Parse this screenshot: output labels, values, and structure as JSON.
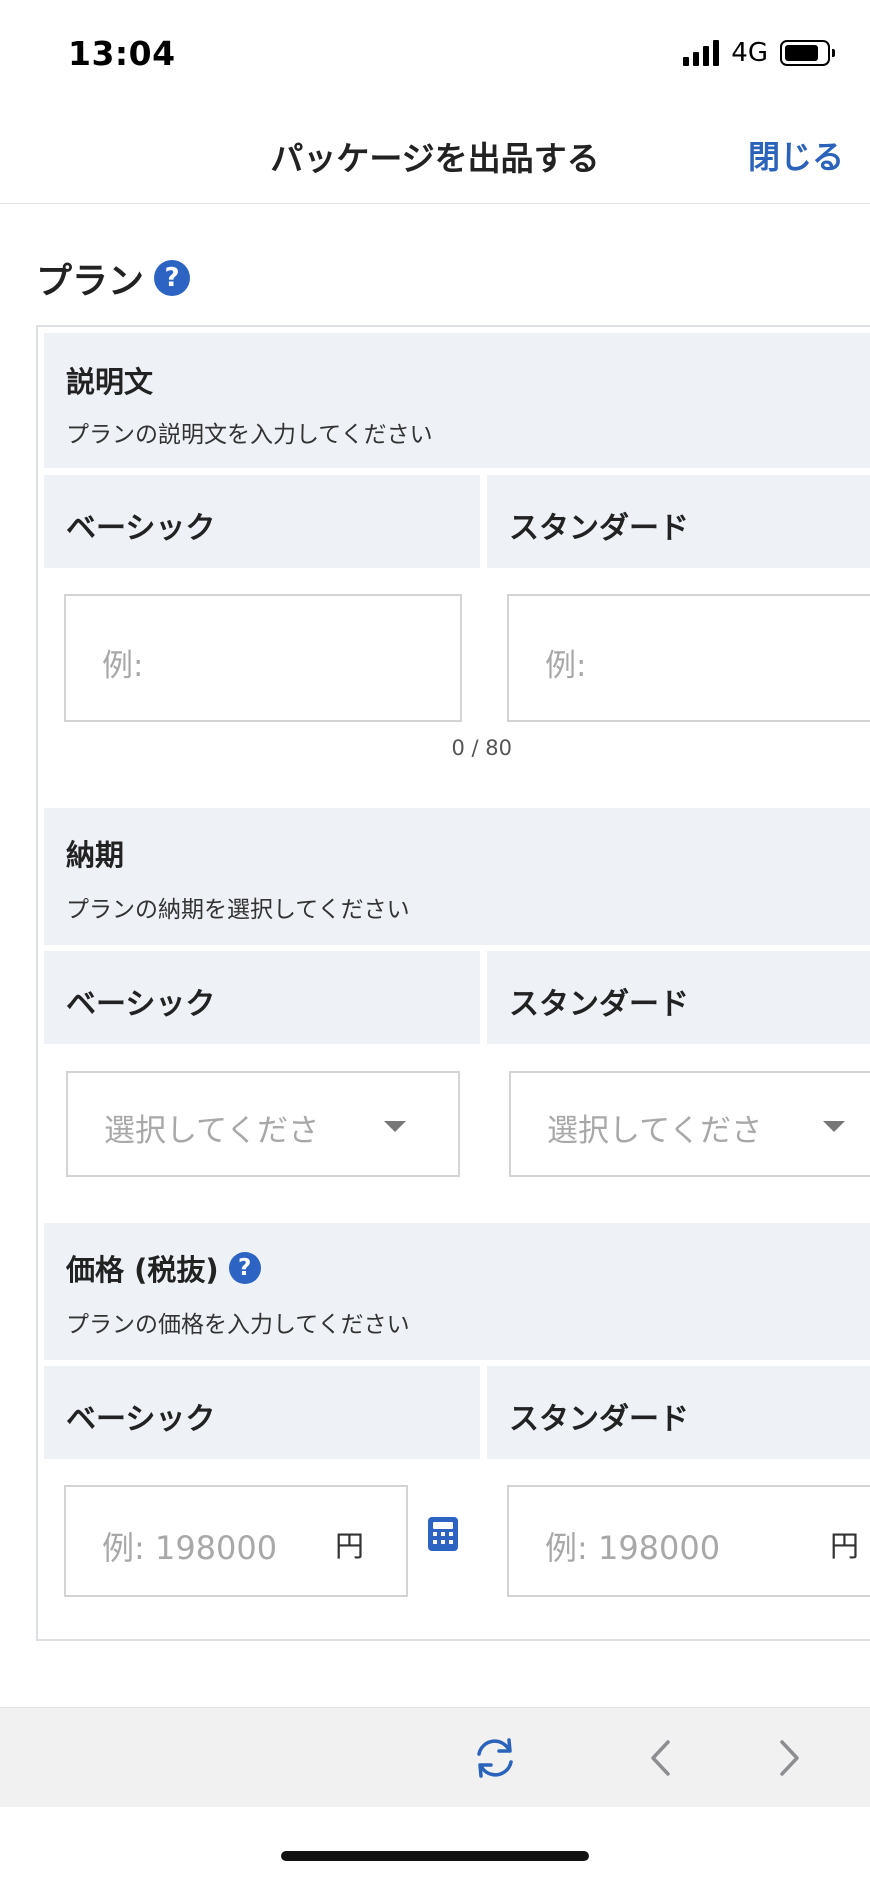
{
  "status_bar": {
    "time": "13:04",
    "network": "4G",
    "icons": [
      "signal-icon",
      "battery-icon"
    ]
  },
  "header": {
    "title": "パッケージを出品する",
    "close_label": "閉じる"
  },
  "plan": {
    "title": "プラン",
    "help_icon": "question-circle-icon"
  },
  "description_section": {
    "title": "説明文",
    "hint": "プランの説明文を入力してください",
    "columns": [
      {
        "label": "ベーシック",
        "placeholder": "例:",
        "counter": "0 / 80"
      },
      {
        "label": "スタンダード",
        "placeholder": "例:"
      }
    ]
  },
  "delivery_section": {
    "title": "納期",
    "hint": "プランの納期を選択してください",
    "columns": [
      {
        "label": "ベーシック",
        "placeholder": "選択してくださ"
      },
      {
        "label": "スタンダード",
        "placeholder": "選択してくださ"
      }
    ]
  },
  "price_section": {
    "title": "価格 (税抜)",
    "hint": "プランの価格を入力してください",
    "help_icon": "question-circle-icon",
    "calculator_icon": "calculator-icon",
    "columns": [
      {
        "label": "ベーシック",
        "placeholder": "例: 198000",
        "unit": "円"
      },
      {
        "label": "スタンダード",
        "placeholder": "例: 198000",
        "unit": "円"
      }
    ]
  },
  "toolbar": {
    "icons": [
      "refresh-icon",
      "back-arrow-icon",
      "forward-arrow-icon"
    ],
    "accent_color": "#2a63b9"
  },
  "colors": {
    "accent": "#2d63c2",
    "header_bg": "#eef1f6",
    "border": "#d3d3d3"
  }
}
